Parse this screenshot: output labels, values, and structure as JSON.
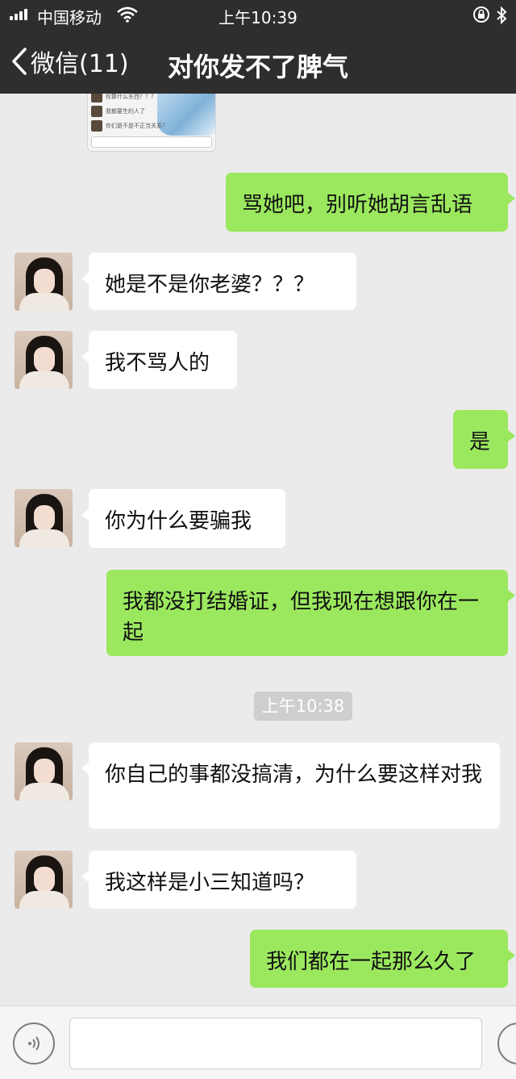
{
  "status_bar": {
    "carrier": "中国移动",
    "time": "上午10:39"
  },
  "nav": {
    "back_label": "微信(11)",
    "title": "对你发不了脾气"
  },
  "shared_screenshot": {
    "lines": [
      "你算什么东西？？？",
      "我都要生的人了",
      "你们是不是不正当关系？"
    ]
  },
  "messages": [
    {
      "side": "out",
      "text": "骂她吧，别听她胡言乱语"
    },
    {
      "side": "in",
      "text": "她是不是你老婆？？？"
    },
    {
      "side": "in",
      "text": "我不骂人的"
    },
    {
      "side": "out",
      "text": "是"
    },
    {
      "side": "in",
      "text": "你为什么要骗我"
    },
    {
      "side": "out",
      "text": "我都没打结婚证，但我现在想跟你在一起"
    },
    {
      "side": "in",
      "text": "你自己的事都没搞清，为什么要这样对我"
    },
    {
      "side": "in",
      "text": "我这样是小三知道吗？"
    },
    {
      "side": "out",
      "text": "我们都在一起那么久了"
    }
  ],
  "timestamp": "上午10:38",
  "colors": {
    "header_bg": "#2e2e2e",
    "chat_bg": "#ebebeb",
    "outgoing_bubble": "#9be85e",
    "incoming_bubble": "#ffffff",
    "timestamp_bg": "#cecece"
  },
  "icons": {
    "back": "chevron-left-icon",
    "voice": "voice-icon",
    "emoji": "emoji-icon",
    "wifi": "wifi-icon",
    "lock": "orientation-lock-icon",
    "bluetooth": "bluetooth-icon"
  }
}
